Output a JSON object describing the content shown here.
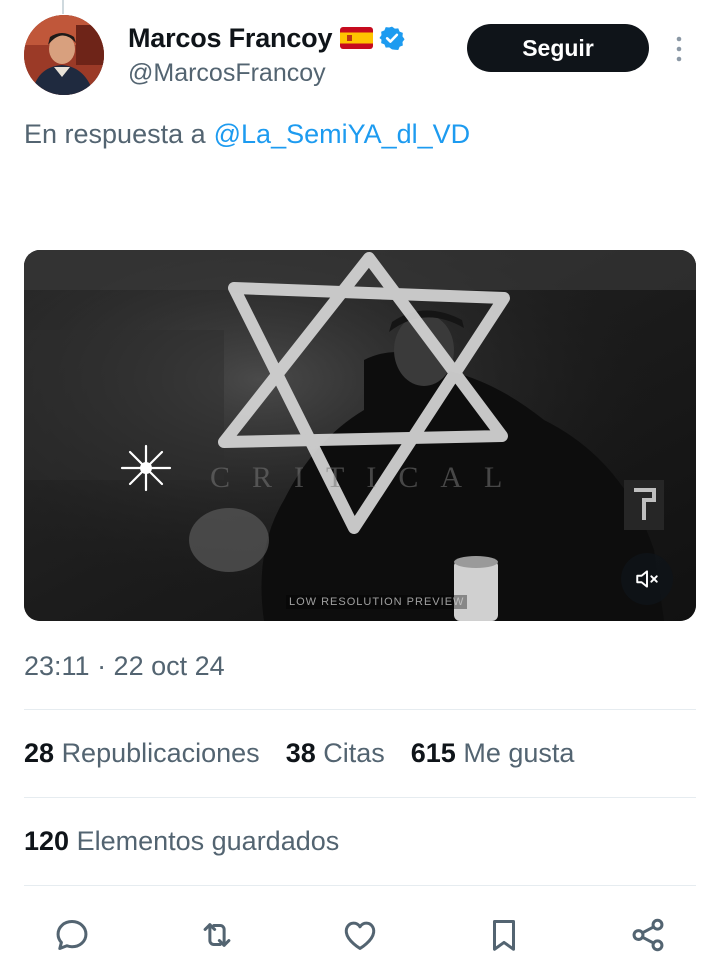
{
  "tweet": {
    "author": {
      "display_name": "Marcos Francoy",
      "handle": "@MarcosFrancoy",
      "flag_icon": "spain-flag-icon",
      "verified_icon": "verified-badge-icon",
      "verified_color": "#1d9bf0"
    },
    "follow_label": "Seguir",
    "reply_prefix": "En respuesta a",
    "reply_mention": "@La_SemiYA_dl_VD",
    "media": {
      "type": "video",
      "watermark_text": "CRITICAL",
      "preview_text": "LOW RESOLUTION PREVIEW",
      "mute_icon": "volume-muted-icon"
    },
    "timestamp": "23:11 · 22 oct 24",
    "stats": [
      {
        "count": "28",
        "label": "Republicaciones"
      },
      {
        "count": "38",
        "label": "Citas"
      },
      {
        "count": "615",
        "label": "Me gusta"
      }
    ],
    "saved": {
      "count": "120",
      "label": "Elementos guardados"
    },
    "actions": [
      "reply-icon",
      "retweet-icon",
      "like-icon",
      "bookmark-icon",
      "share-icon"
    ]
  },
  "colors": {
    "text_primary": "#0f1419",
    "text_secondary": "#536471",
    "link": "#1d9bf0",
    "button_bg": "#0f1419",
    "divider": "#e6ecf0"
  }
}
